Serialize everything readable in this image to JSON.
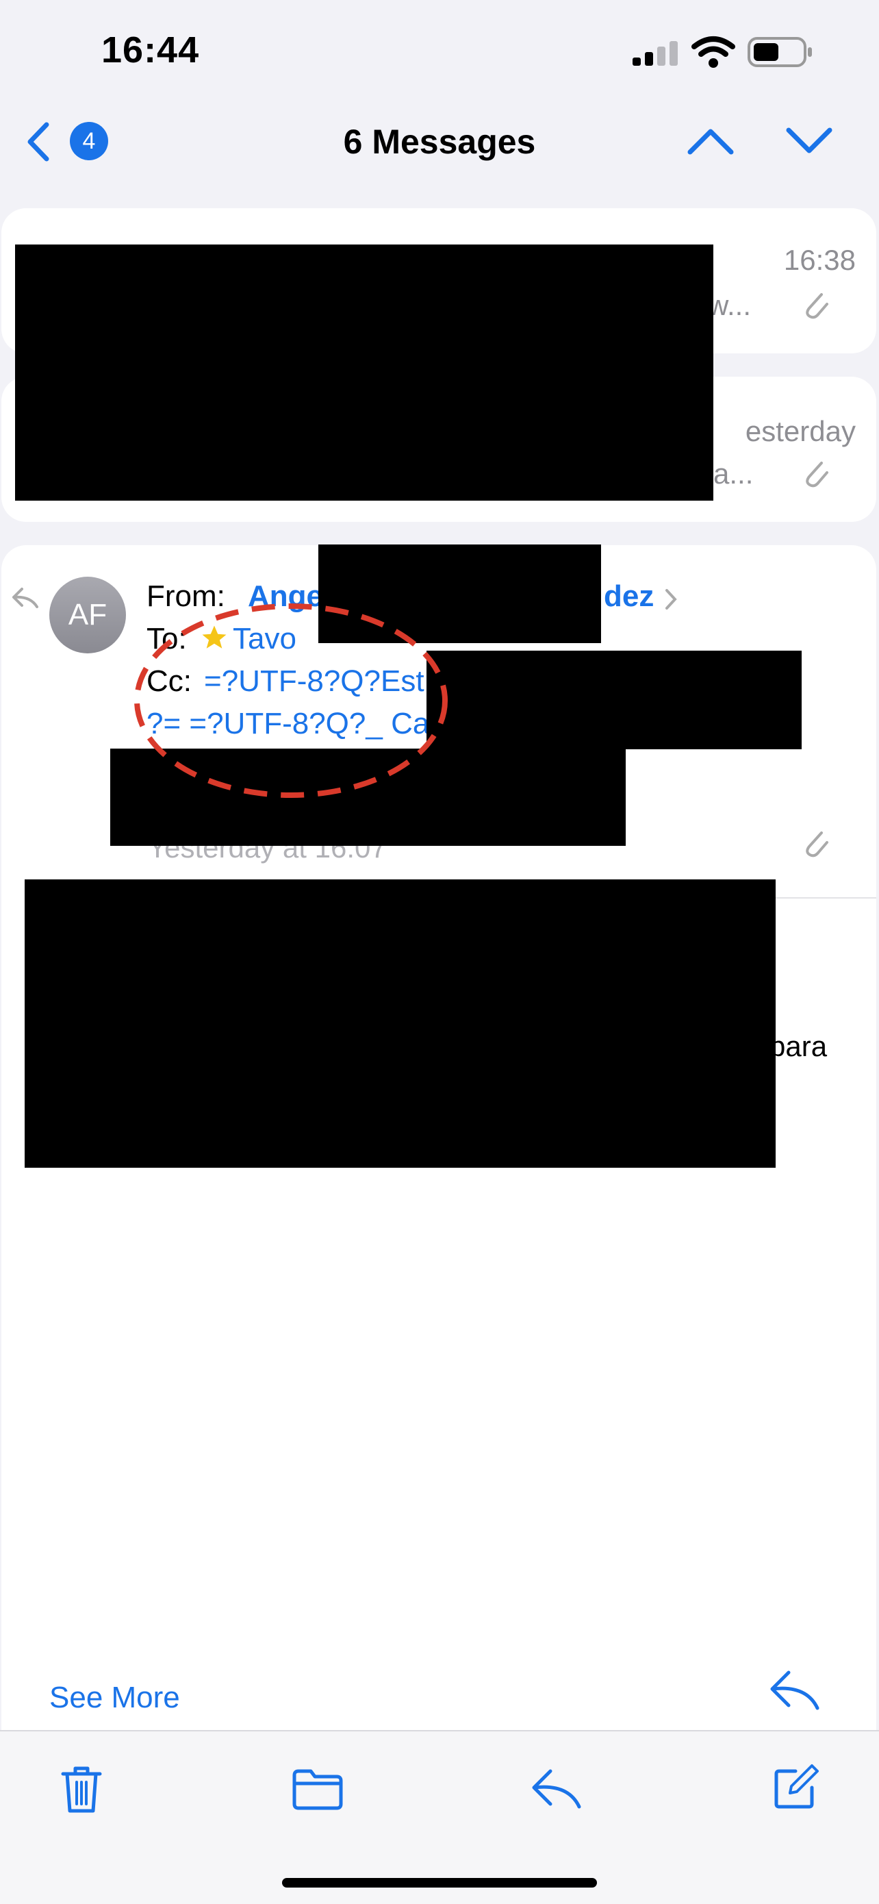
{
  "status_bar": {
    "time": "16:44"
  },
  "nav": {
    "back_count": "4",
    "title": "6 Messages"
  },
  "messages": [
    {
      "time": "16:38",
      "snippet_end": "w..."
    },
    {
      "time": "esterday",
      "snippet_end": "a..."
    }
  ],
  "detail": {
    "avatar_initials": "AF",
    "from_label": "From:",
    "from_name_start": "Ange",
    "from_name_end": "dez",
    "to_label": "To:",
    "to_name": "Tavo",
    "cc_label": "Cc:",
    "cc_line1": "=?UTF-8?Q?Est",
    "cc_line2": "?= =?UTF-8?Q?_ Ca",
    "date": "Yesterday at 16:07",
    "body_fragment": "para"
  },
  "actions": {
    "see_more": "See More"
  },
  "colors": {
    "accent": "#1a73e8",
    "annotation": "#d93a2b",
    "star": "#f5c518"
  },
  "icons": [
    "chevron-left-icon",
    "chevron-up-icon",
    "chevron-down-icon",
    "paperclip-icon",
    "reply-icon",
    "trash-icon",
    "folder-icon",
    "compose-icon",
    "signal-icon",
    "wifi-icon",
    "battery-icon",
    "star-icon"
  ]
}
